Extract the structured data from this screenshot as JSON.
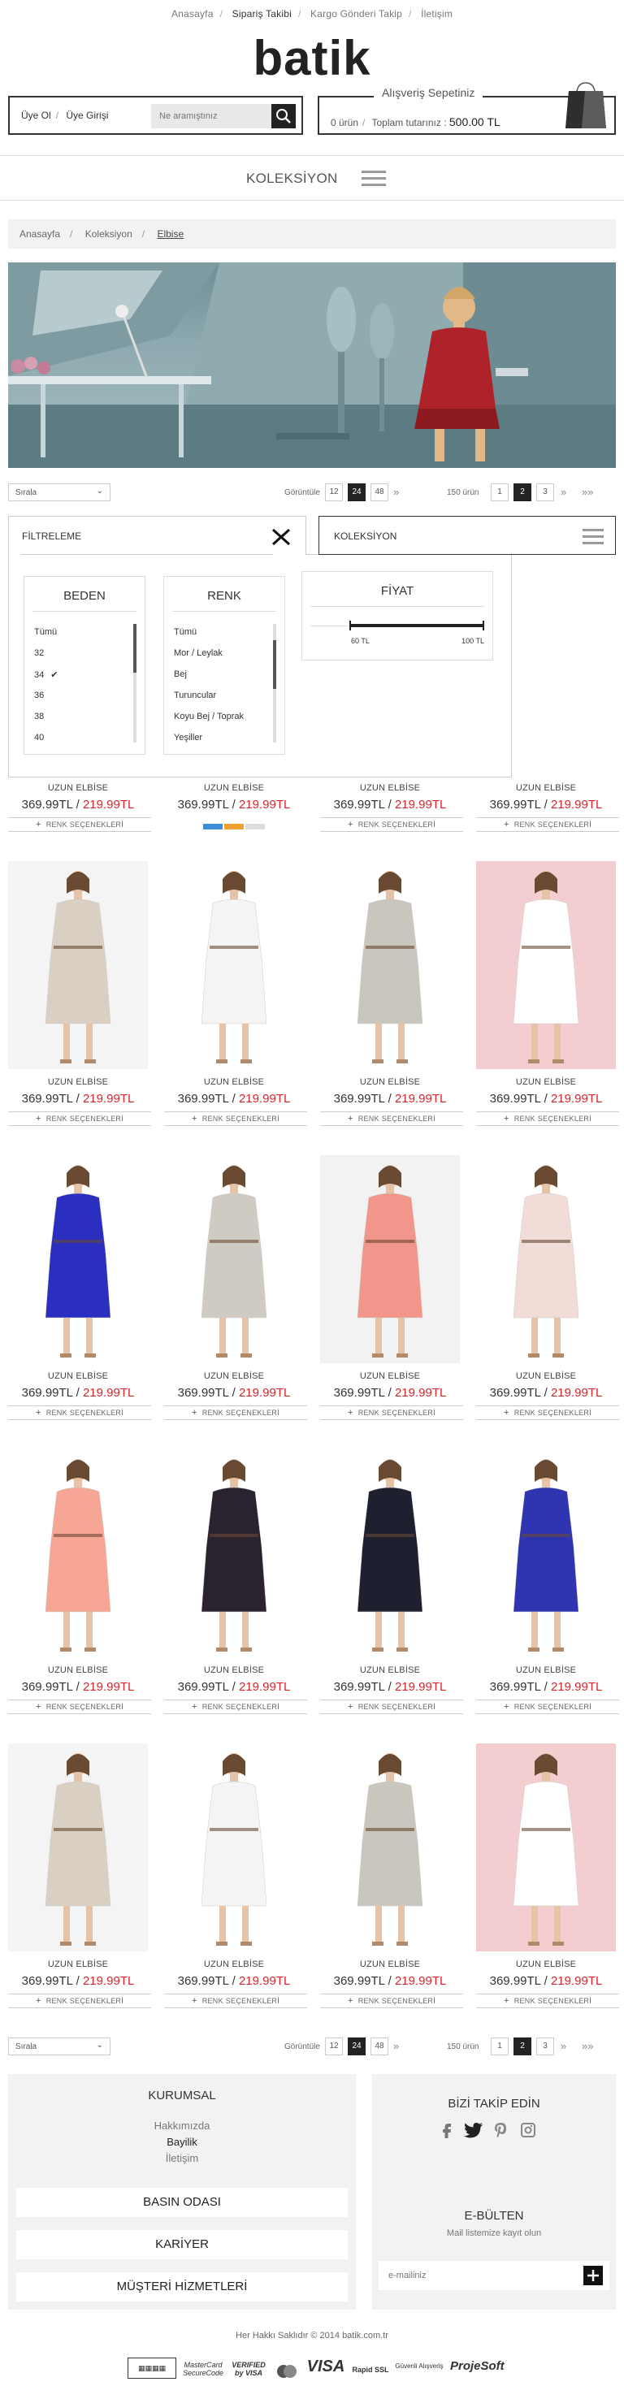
{
  "topnav": {
    "items": [
      "Anasayfa",
      "Sipariş Takibi",
      "Kargo Gönderi Takip",
      "İletişim"
    ]
  },
  "brand": {
    "logo": "batik"
  },
  "account": {
    "login_label": "Üye Ol",
    "signup_label": "Üye Girişi"
  },
  "search": {
    "placeholder": "Ne aramıştınız"
  },
  "cart": {
    "title": "Alışveriş Sepetiniz",
    "count": "0 ürün",
    "total_label": "Toplam tutarınız :",
    "total_value": "500.00 TL"
  },
  "menu": {
    "collection_label": "KOLEKSİYON"
  },
  "breadcrumb": [
    "Anasayfa",
    "Koleksiyon",
    "Elbise"
  ],
  "pager": {
    "sort_label": "Sırala",
    "view_label": "Görüntüle",
    "view_options": [
      "12",
      "24",
      "48"
    ],
    "view_selected": "24",
    "count_label": "150 ürün",
    "pages": [
      "1",
      "2",
      "3"
    ],
    "current_page": "2"
  },
  "filter": {
    "title": "FİLTRELEME",
    "collection_label": "KOLEKSİYON",
    "size": {
      "title": "BEDEN",
      "options": [
        "Tümü",
        "32",
        "34",
        "36",
        "38",
        "40"
      ],
      "checked": "34"
    },
    "color": {
      "title": "RENK",
      "options": [
        "Tümü",
        "Mor / Leylak",
        "Bej",
        "Turuncular",
        "Koyu Bej / Toprak",
        "Yeşiller"
      ]
    },
    "price": {
      "title": "FİYAT",
      "min": "60 TL",
      "max": "100 TL"
    }
  },
  "products": [
    {
      "name": "UZUN ELBİSE",
      "old": "369.99TL",
      "sale": "219.99TL",
      "colors": "RENK SEÇENEKLERİ",
      "dress": "#2f35b0",
      "bg": "#ffffff"
    },
    {
      "name": "UZUN ELBİSE",
      "old": "369.99TL",
      "sale": "219.99TL",
      "colors": "",
      "dress": "",
      "bg": "#ffffff"
    },
    {
      "name": "UZUN ELBİSE",
      "old": "369.99TL",
      "sale": "219.99TL",
      "colors": "RENK SEÇENEKLERİ",
      "dress": "",
      "bg": "#ffffff"
    },
    {
      "name": "UZUN ELBİSE",
      "old": "369.99TL",
      "sale": "219.99TL",
      "colors": "RENK SEÇENEKLERİ",
      "dress": "",
      "bg": "#ffffff"
    },
    {
      "name": "UZUN ELBİSE",
      "old": "369.99TL",
      "sale": "219.99TL",
      "colors": "RENK SEÇENEKLERİ",
      "dress": "#d9cfc2",
      "bg": "#f4f4f4"
    },
    {
      "name": "UZUN ELBİSE",
      "old": "369.99TL",
      "sale": "219.99TL",
      "colors": "RENK SEÇENEKLERİ",
      "dress": "#f4f4f4",
      "bg": "#ffffff"
    },
    {
      "name": "UZUN ELBİSE",
      "old": "369.99TL",
      "sale": "219.99TL",
      "colors": "RENK SEÇENEKLERİ",
      "dress": "#c9c6bd",
      "bg": "#ffffff"
    },
    {
      "name": "UZUN ELBİSE",
      "old": "369.99TL",
      "sale": "219.99TL",
      "colors": "RENK SEÇENEKLERİ",
      "dress": "#ffffff",
      "bg": "#f4cdd0"
    },
    {
      "name": "UZUN ELBİSE",
      "old": "369.99TL",
      "sale": "219.99TL",
      "colors": "RENK SEÇENEKLERİ",
      "dress": "#2a2fc0",
      "bg": "#ffffff"
    },
    {
      "name": "UZUN ELBİSE",
      "old": "369.99TL",
      "sale": "219.99TL",
      "colors": "RENK SEÇENEKLERİ",
      "dress": "#cfcac2",
      "bg": "#ffffff"
    },
    {
      "name": "UZUN ELBİSE",
      "old": "369.99TL",
      "sale": "219.99TL",
      "colors": "RENK SEÇENEKLERİ",
      "dress": "#f2958a",
      "bg": "#f2f2f2"
    },
    {
      "name": "UZUN ELBİSE",
      "old": "369.99TL",
      "sale": "219.99TL",
      "colors": "RENK SEÇENEKLERİ",
      "dress": "#f1dcd8",
      "bg": "#ffffff"
    },
    {
      "name": "UZUN ELBİSE",
      "old": "369.99TL",
      "sale": "219.99TL",
      "colors": "RENK SEÇENEKLERİ",
      "dress": "#f7a594",
      "bg": "#ffffff"
    },
    {
      "name": "UZUN ELBİSE",
      "old": "369.99TL",
      "sale": "219.99TL",
      "colors": "RENK SEÇENEKLERİ",
      "dress": "#2b2230",
      "bg": "#ffffff"
    },
    {
      "name": "UZUN ELBİSE",
      "old": "369.99TL",
      "sale": "219.99TL",
      "colors": "RENK SEÇENEKLERİ",
      "dress": "#1e2030",
      "bg": "#ffffff"
    },
    {
      "name": "UZUN ELBİSE",
      "old": "369.99TL",
      "sale": "219.99TL",
      "colors": "RENK SEÇENEKLERİ",
      "dress": "#2f35b0",
      "bg": "#ffffff"
    },
    {
      "name": "UZUN ELBİSE",
      "old": "369.99TL",
      "sale": "219.99TL",
      "colors": "RENK SEÇENEKLERİ",
      "dress": "#d9cfc2",
      "bg": "#f4f4f4"
    },
    {
      "name": "UZUN ELBİSE",
      "old": "369.99TL",
      "sale": "219.99TL",
      "colors": "RENK SEÇENEKLERİ",
      "dress": "#f4f4f4",
      "bg": "#ffffff"
    },
    {
      "name": "UZUN ELBİSE",
      "old": "369.99TL",
      "sale": "219.99TL",
      "colors": "RENK SEÇENEKLERİ",
      "dress": "#c9c6bd",
      "bg": "#ffffff"
    },
    {
      "name": "UZUN ELBİSE",
      "old": "369.99TL",
      "sale": "219.99TL",
      "colors": "RENK SEÇENEKLERİ",
      "dress": "#ffffff",
      "bg": "#f4cdd0"
    }
  ],
  "swatches": [
    "#3a8fd6",
    "#f0a02c",
    "#dddddd"
  ],
  "footer": {
    "corporate_title": "KURUMSAL",
    "corporate_links": [
      "Hakkımızda",
      "Bayilik",
      "İletişim"
    ],
    "buttons": [
      "BASIN ODASI",
      "KARİYER",
      "MÜŞTERİ HİZMETLERİ"
    ],
    "follow_title": "BİZİ TAKİP EDİN",
    "social_icons": [
      "facebook-icon",
      "twitter-icon",
      "pinterest-icon",
      "instagram-icon"
    ],
    "newsletter_title": "E-BÜLTEN",
    "newsletter_text": "Mail listemize kayıt olun",
    "newsletter_placeholder": "e-mailiniz",
    "copyright": "Her Hakkı Saklıdır © 2014 batik.com.tr",
    "payment_logos": [
      "MasterCard SecureCode",
      "VERIFIED by VISA",
      "MasterCard",
      "VISA",
      "Rapid SSL",
      "Güvenli Alışveriş",
      "ProjeSoft"
    ]
  }
}
